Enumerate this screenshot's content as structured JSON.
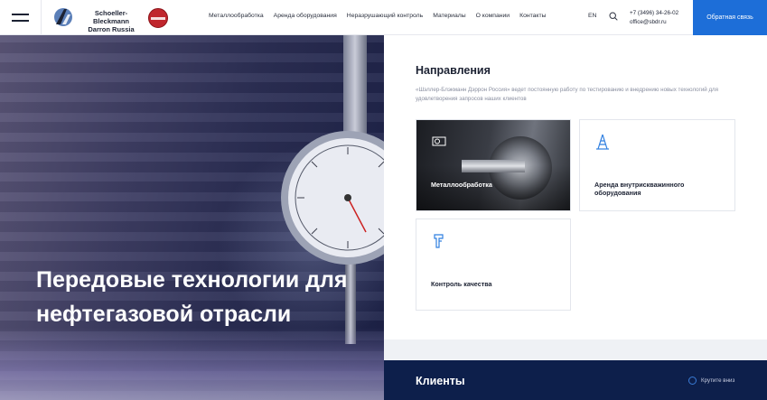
{
  "header": {
    "logo_line1": "Schoeller-Bleckmann",
    "logo_line2": "Darron Russia",
    "nav": [
      "Металлообработка",
      "Аренда оборудования",
      "Неразрушающий контроль",
      "Материалы",
      "О компании",
      "Контакты"
    ],
    "lang": "EN",
    "phone": "+7 (3496) 34-26-02",
    "email": "office@sbdr.ru",
    "callback_label": "Обратная связь"
  },
  "hero": {
    "title": "Передовые технологии для нефтегазовой отрасли"
  },
  "directions": {
    "title": "Направления",
    "description": "«Шэллер-Блэкманн Дэррон Россия» ведет постоянную работу по тестированию и внедрению новых технологий для удовлетворения запросов наших клиентов",
    "cards": [
      {
        "label": "Металлообработка",
        "icon": "lathe-icon"
      },
      {
        "label": "Аренда внутрискважинного оборудования",
        "icon": "drilling-rig-icon"
      },
      {
        "label": "Контроль качества",
        "icon": "caliper-icon"
      }
    ]
  },
  "clients": {
    "title": "Клиенты",
    "scroll_label": "Крутите вниз"
  },
  "colors": {
    "accent": "#1d6ed8",
    "dark_navy": "#0d1f4b",
    "text": "#1c2233"
  }
}
